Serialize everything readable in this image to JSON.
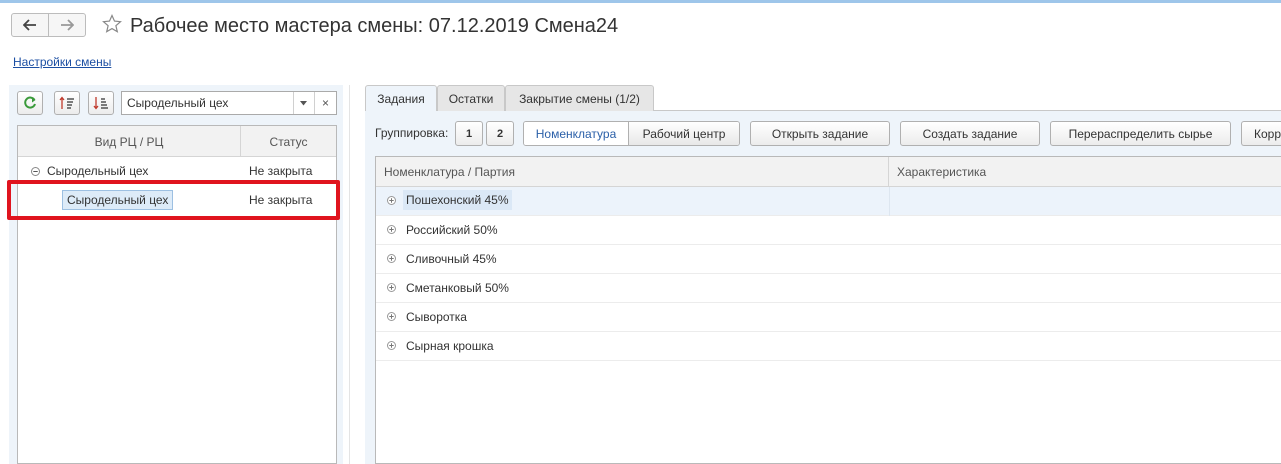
{
  "header": {
    "title": "Рабочее место мастера смены: 07.12.2019 Смена24",
    "icons": [
      "arrow-left-icon",
      "arrow-right-icon",
      "star-icon"
    ]
  },
  "settings_link": "Настройки смены",
  "left_panel": {
    "combo_value": "Сыродельный цех",
    "combo_clear": "×",
    "table": {
      "columns": [
        "Вид РЦ / РЦ",
        "Статус"
      ],
      "rows": [
        {
          "name": "Сыродельный цех",
          "status": "Не закрыта"
        },
        {
          "name": "Сыродельный цех",
          "status": "Не закрыта"
        }
      ]
    }
  },
  "tabs": [
    "Задания",
    "Остатки",
    "Закрытие смены (1/2)"
  ],
  "toolbar": {
    "grouping_label": "Группировка:",
    "level_buttons": [
      "1",
      "2"
    ],
    "grouping_options": [
      "Номенклатура",
      "Рабочий центр"
    ],
    "open_task": "Открыть задание",
    "create_task": "Создать задание",
    "redistribute": "Перераспределить сырье",
    "cut_button": "Корр"
  },
  "main_table": {
    "columns": [
      "Номенклатура / Партия",
      "Характеристика"
    ],
    "rows": [
      "Пошехонский 45%",
      "Российский 50%",
      "Сливочный 45%",
      "Сметанковый 50%",
      "Сыворотка",
      "Сырная крошка"
    ]
  },
  "colors": {
    "highlight_frame": "#e0141e",
    "link": "#1c4fa3",
    "refresh_icon": "#3a9a3a"
  }
}
